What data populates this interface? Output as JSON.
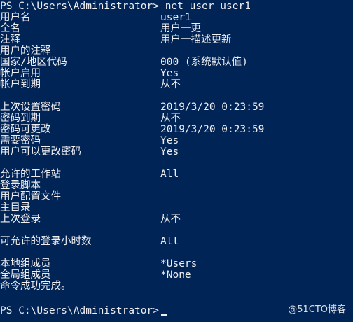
{
  "terminal": {
    "first_prompt": "PS C:\\Users\\Administrator>",
    "first_command": "net user user1",
    "lines": [
      {
        "label": "用户名",
        "value": "user1"
      },
      {
        "label": "全名",
        "value": "用户一更"
      },
      {
        "label": "注释",
        "value": "用户一描述更新"
      },
      {
        "label": "用户的注释",
        "value": ""
      },
      {
        "label": "国家/地区代码",
        "value": "000 (系统默认值)"
      },
      {
        "label": "帐户启用",
        "value": "Yes"
      },
      {
        "label": "帐户到期",
        "value": "从不"
      },
      {
        "label": "",
        "value": ""
      },
      {
        "label": "上次设置密码",
        "value": "2019/3/20 0:23:59"
      },
      {
        "label": "密码到期",
        "value": "从不"
      },
      {
        "label": "密码可更改",
        "value": "2019/3/20 0:23:59"
      },
      {
        "label": "需要密码",
        "value": "Yes"
      },
      {
        "label": "用户可以更改密码",
        "value": "Yes"
      },
      {
        "label": "",
        "value": ""
      },
      {
        "label": "允许的工作站",
        "value": "All"
      },
      {
        "label": "登录脚本",
        "value": ""
      },
      {
        "label": "用户配置文件",
        "value": ""
      },
      {
        "label": "主目录",
        "value": ""
      },
      {
        "label": "上次登录",
        "value": "从不"
      },
      {
        "label": "",
        "value": ""
      },
      {
        "label": "可允许的登录小时数",
        "value": "All"
      },
      {
        "label": "",
        "value": ""
      },
      {
        "label": "本地组成员",
        "value": "*Users"
      },
      {
        "label": "全局组成员",
        "value": "*None"
      },
      {
        "label": "命令成功完成。",
        "value": ""
      }
    ],
    "second_prompt": "PS C:\\Users\\Administrator>",
    "second_command": ""
  },
  "watermark": "@51CTO博客",
  "colors": {
    "background": "#012456",
    "text": "#eeedf0"
  }
}
